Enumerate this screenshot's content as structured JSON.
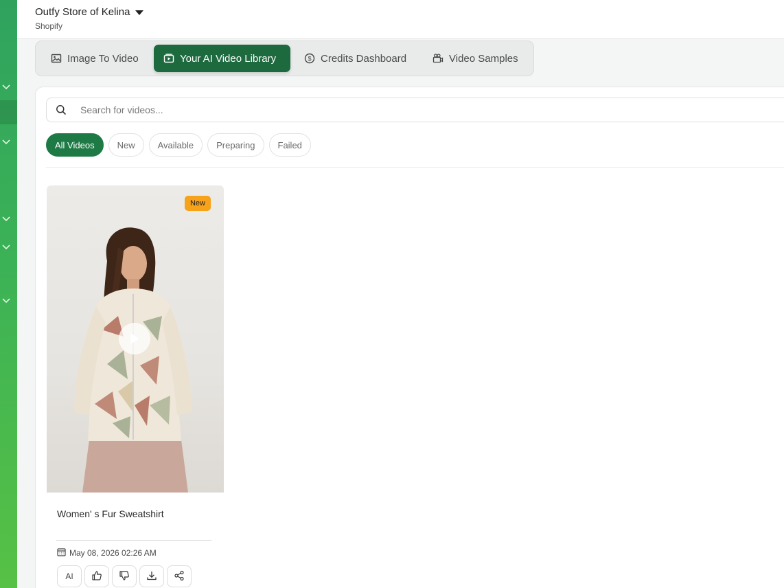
{
  "header": {
    "store_name": "Outfy Store of Kelina",
    "platform": "Shopify"
  },
  "nav": {
    "tabs": [
      {
        "label": "Image To Video",
        "icon": "image-icon",
        "active": false
      },
      {
        "label": "Your AI Video Library",
        "icon": "video-library-icon",
        "active": true
      },
      {
        "label": "Credits Dashboard",
        "icon": "dollar-circle-icon",
        "active": false
      },
      {
        "label": "Video Samples",
        "icon": "video-camera-icon",
        "active": false
      }
    ]
  },
  "search": {
    "placeholder": "Search for videos...",
    "value": ""
  },
  "filters": [
    {
      "label": "All Videos",
      "active": true
    },
    {
      "label": "New",
      "active": false
    },
    {
      "label": "Available",
      "active": false
    },
    {
      "label": "Preparing",
      "active": false
    },
    {
      "label": "Failed",
      "active": false
    }
  ],
  "videos": [
    {
      "title": "Women' s Fur Sweatshirt",
      "badge": "New",
      "date": "May 08, 2026 02:26 AM",
      "actions": {
        "ai_label": "AI",
        "like": "thumbs-up-icon",
        "dislike": "thumbs-down-icon",
        "download": "download-icon",
        "share": "share-icon"
      }
    }
  ],
  "colors": {
    "brand_green": "#1e6a3f",
    "chip_active": "#1e7a45",
    "badge_new": "#f7a21b",
    "rail_top": "#2fa35e",
    "rail_bottom": "#57c145"
  }
}
